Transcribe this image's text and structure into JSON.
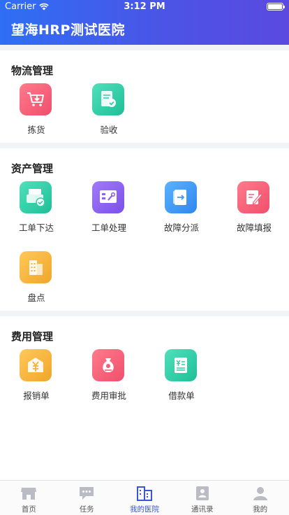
{
  "status_bar": {
    "carrier": "Carrier",
    "time": "3:12 PM"
  },
  "header": {
    "title": "望海HRP测试医院"
  },
  "sections": [
    {
      "title": "物流管理",
      "items": [
        {
          "label": "拣货",
          "icon": "cart-down-icon",
          "color": "#f2617a"
        },
        {
          "label": "验收",
          "icon": "doc-check-icon",
          "color": "#2ecfa7"
        }
      ]
    },
    {
      "title": "资产管理",
      "items": [
        {
          "label": "工单下达",
          "icon": "printer-check-icon",
          "color": "#2ecfa7"
        },
        {
          "label": "工单处理",
          "icon": "wrench-board-icon",
          "color": "#8e64f2"
        },
        {
          "label": "故障分派",
          "icon": "doc-arrow-icon",
          "color": "#3f9af7"
        },
        {
          "label": "故障填报",
          "icon": "pencil-doc-icon",
          "color": "#f2617a"
        },
        {
          "label": "盘点",
          "icon": "building-icon",
          "color": "#f3b13a"
        }
      ]
    },
    {
      "title": "费用管理",
      "items": [
        {
          "label": "报销单",
          "icon": "yuan-envelope-icon",
          "color": "#f3b13a"
        },
        {
          "label": "费用审批",
          "icon": "money-bag-icon",
          "color": "#f2617a"
        },
        {
          "label": "借款单",
          "icon": "yuan-receipt-icon",
          "color": "#2ecfa7"
        }
      ]
    }
  ],
  "tabbar": {
    "active": "我的医院",
    "items": [
      {
        "label": "首页",
        "icon": "store-icon"
      },
      {
        "label": "任务",
        "icon": "chat-bubble-icon"
      },
      {
        "label": "我的医院",
        "icon": "hospital-icon"
      },
      {
        "label": "通讯录",
        "icon": "contact-book-icon"
      },
      {
        "label": "我的",
        "icon": "person-icon"
      }
    ]
  },
  "colors": {
    "header_start": "#2e6ff5",
    "header_end": "#5b49e0",
    "tab_active": "#3a55d8",
    "tab_inactive": "#b9bcc4"
  }
}
